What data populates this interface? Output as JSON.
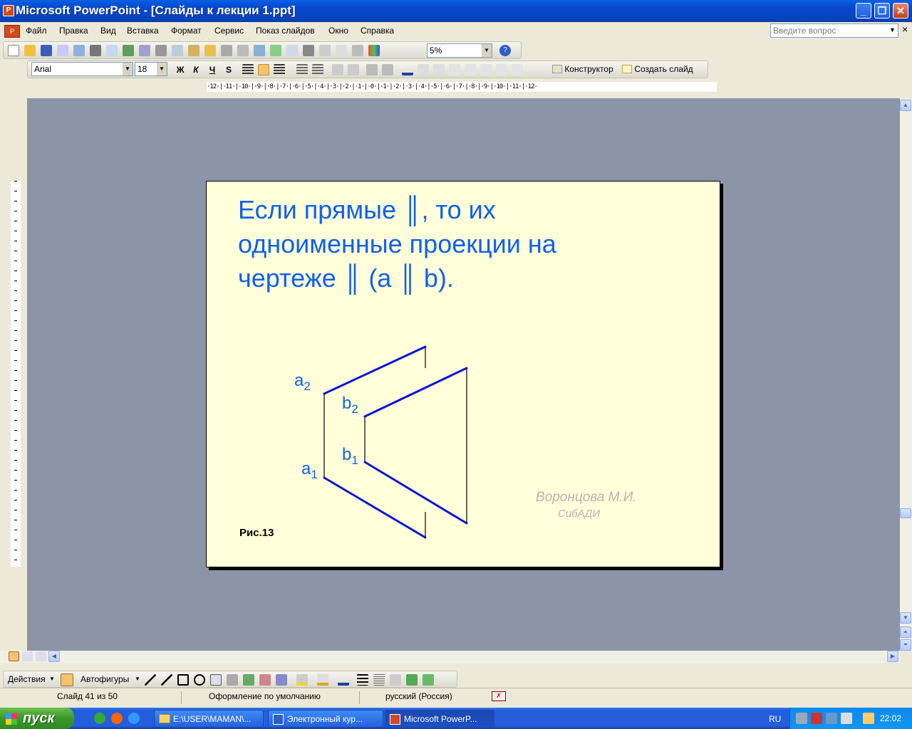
{
  "window": {
    "title": "Microsoft PowerPoint - [Слайды к лекции 1.ppt]",
    "app_icon": "P"
  },
  "menu": {
    "items": [
      "Файл",
      "Правка",
      "Вид",
      "Вставка",
      "Формат",
      "Сервис",
      "Показ слайдов",
      "Окно",
      "Справка"
    ],
    "help_placeholder": "Введите вопрос"
  },
  "toolbar": {
    "zoom": "5%"
  },
  "format_toolbar": {
    "font": "Arial",
    "size": "18",
    "bold": "Ж",
    "italic": "К",
    "underline": "Ч",
    "shadow": "S",
    "designer_label": "Конструктор",
    "new_slide_label": "Создать слайд"
  },
  "ruler": {
    "horizontal": "·12·|·11·|·10·|·9·|·8·|·7·|·6·|·5·|·4·|·3·|·2·|·1·|·0·|·1·|·2·|·3·|·4·|·5·|·6·|·7·|·8·|·9·|·10·|·11·|·12·"
  },
  "slide": {
    "title_lines": [
      " Если прямые ║, то их",
      "одноименные проекции на",
      "чертеже ║ (a ║ b)."
    ],
    "labels": {
      "a2": "a",
      "a2_sub": "2",
      "b2": "b",
      "b2_sub": "2",
      "b1": "b",
      "b1_sub": "1",
      "a1": "a",
      "a1_sub": "1"
    },
    "caption": "Рис.13",
    "author": "Воронцова М.И.",
    "institution": "СибАДИ",
    "line_color": "#0a14d8",
    "text_color": "#1060f0"
  },
  "drawing_toolbar": {
    "actions_label": "Действия",
    "autoshapes_label": "Автофигуры"
  },
  "status": {
    "slide_counter": "Слайд 41 из 50",
    "design": "Оформление по умолчанию",
    "language": "русский (Россия)"
  },
  "taskbar": {
    "start_label": "пуск",
    "buttons": [
      "E:\\USER\\MAMAN\\...",
      "Электронный кур...",
      "Microsoft PowerP..."
    ],
    "language_indicator": "RU",
    "clock": "22:02"
  }
}
